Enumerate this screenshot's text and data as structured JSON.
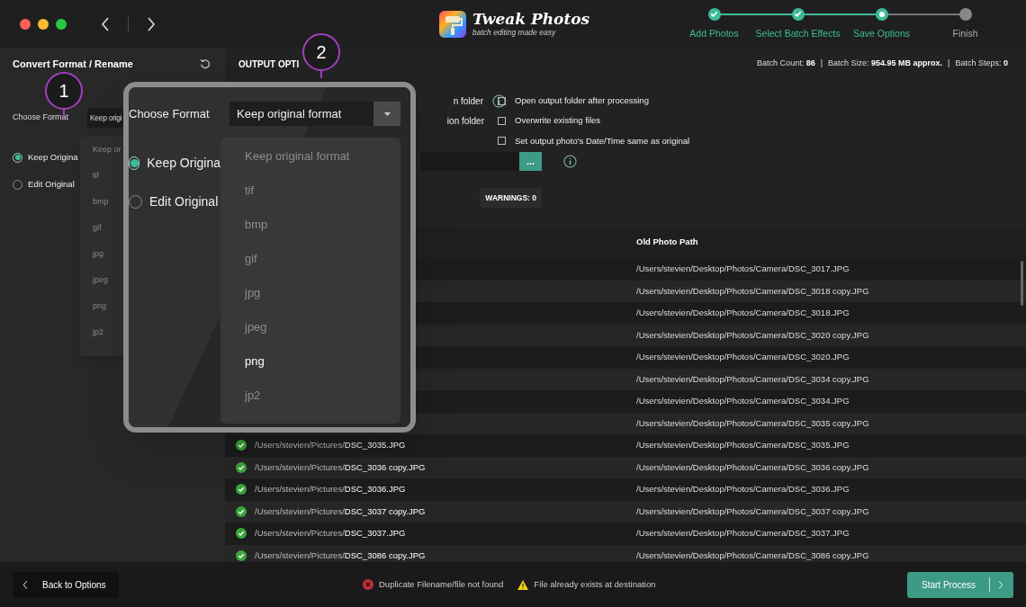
{
  "app": {
    "title": "Tweak Photos",
    "subtitle": "batch editing made easy"
  },
  "steps": [
    {
      "label": "Add Photos",
      "done": true,
      "current": false
    },
    {
      "label": "Select Batch Effects",
      "done": true,
      "current": false
    },
    {
      "label": "Save Options",
      "done": false,
      "current": true
    },
    {
      "label": "Finish",
      "done": false,
      "current": false
    }
  ],
  "sidebar": {
    "title": "Convert Format / Rename",
    "format_label": "Choose Format",
    "format_value": "Keep origi",
    "format_list": [
      {
        "label": "Keep or",
        "hovered": false
      },
      {
        "label": "tif",
        "hovered": false
      },
      {
        "label": "bmp",
        "hovered": false
      },
      {
        "label": "gif",
        "hovered": false
      },
      {
        "label": "jpg",
        "hovered": false
      },
      {
        "label": "jpeg",
        "hovered": false
      },
      {
        "label": "png",
        "hovered": false
      },
      {
        "label": "jp2",
        "hovered": false
      }
    ],
    "radios": [
      {
        "label": "Keep Origina",
        "selected": true
      },
      {
        "label": "Edit Original",
        "selected": false
      }
    ]
  },
  "output": {
    "title": "OUTPUT OPTI",
    "batch_info": [
      {
        "label": "Batch Count:",
        "value": "86"
      },
      {
        "label": "Batch Size:",
        "value": "954.95 MB approx."
      },
      {
        "label": "Batch Steps:",
        "value": "0"
      }
    ],
    "separator": "|",
    "folder_options": [
      "n folder",
      "ion folder"
    ],
    "checkboxes": [
      {
        "label": "Open output folder after processing",
        "checked": false
      },
      {
        "label": "Overwrite existing files",
        "checked": false
      },
      {
        "label": "Set output photo's Date/Time same as original",
        "checked": false
      }
    ],
    "browse_button": "...",
    "warnings": "WARNINGS: 0"
  },
  "table": {
    "columns": [
      "Old Photo Path"
    ],
    "rows": [
      {
        "old_path": "/Users/stevien/Desktop/Photos/Camera/DSC_3017.JPG"
      },
      {
        "old_path": "/Users/stevien/Desktop/Photos/Camera/DSC_3018 copy.JPG"
      },
      {
        "old_path": "/Users/stevien/Desktop/Photos/Camera/DSC_3018.JPG"
      },
      {
        "old_path": "/Users/stevien/Desktop/Photos/Camera/DSC_3020 copy.JPG"
      },
      {
        "old_path": "/Users/stevien/Desktop/Photos/Camera/DSC_3020.JPG"
      },
      {
        "old_path": "/Users/stevien/Desktop/Photos/Camera/DSC_3034 copy.JPG"
      },
      {
        "old_path": "/Users/stevien/Desktop/Photos/Camera/DSC_3034.JPG"
      },
      {
        "old_path": "/Users/stevien/Desktop/Photos/Camera/DSC_3035 copy.JPG"
      },
      {
        "done": true,
        "new_dir": "/Users/stevien/Pictures/",
        "new_file": "DSC_3035.JPG",
        "old_path": "/Users/stevien/Desktop/Photos/Camera/DSC_3035.JPG"
      },
      {
        "done": true,
        "new_dir": "/Users/stevien/Pictures/",
        "new_file": "DSC_3036 copy.JPG",
        "old_path": "/Users/stevien/Desktop/Photos/Camera/DSC_3036 copy.JPG"
      },
      {
        "done": true,
        "new_dir": "/Users/stevien/Pictures/",
        "new_file": "DSC_3036.JPG",
        "old_path": "/Users/stevien/Desktop/Photos/Camera/DSC_3036.JPG"
      },
      {
        "done": true,
        "new_dir": "/Users/stevien/Pictures/",
        "new_file": "DSC_3037 copy.JPG",
        "old_path": "/Users/stevien/Desktop/Photos/Camera/DSC_3037 copy.JPG"
      },
      {
        "done": true,
        "new_dir": "/Users/stevien/Pictures/",
        "new_file": "DSC_3037.JPG",
        "old_path": "/Users/stevien/Desktop/Photos/Camera/DSC_3037.JPG"
      },
      {
        "done": true,
        "new_dir": "/Users/stevien/Pictures/",
        "new_file": "DSC_3086 copy.JPG",
        "old_path": "/Users/stevien/Desktop/Photos/Camera/DSC_3086 copy.JPG"
      }
    ]
  },
  "magnifier": {
    "format_label": "Choose Format",
    "format_value": "Keep original format",
    "format_list": [
      {
        "label": "Keep original format",
        "hovered": false
      },
      {
        "label": "tif",
        "hovered": false
      },
      {
        "label": "bmp",
        "hovered": false
      },
      {
        "label": "gif",
        "hovered": false
      },
      {
        "label": "jpg",
        "hovered": false
      },
      {
        "label": "jpeg",
        "hovered": false
      },
      {
        "label": "png",
        "hovered": true
      },
      {
        "label": "jp2",
        "hovered": false
      }
    ],
    "radios": [
      {
        "label": "Keep Origina",
        "selected": true
      },
      {
        "label": "Edit Original",
        "selected": false
      }
    ]
  },
  "callouts": [
    {
      "number": "1"
    },
    {
      "number": "2"
    }
  ],
  "footer": {
    "back_button": "Back to Options",
    "legend": [
      {
        "kind": "error",
        "label": "Duplicate Filename/file not found"
      },
      {
        "kind": "warning",
        "label": "File already exists at destination"
      }
    ],
    "start_button": "Start Process"
  }
}
